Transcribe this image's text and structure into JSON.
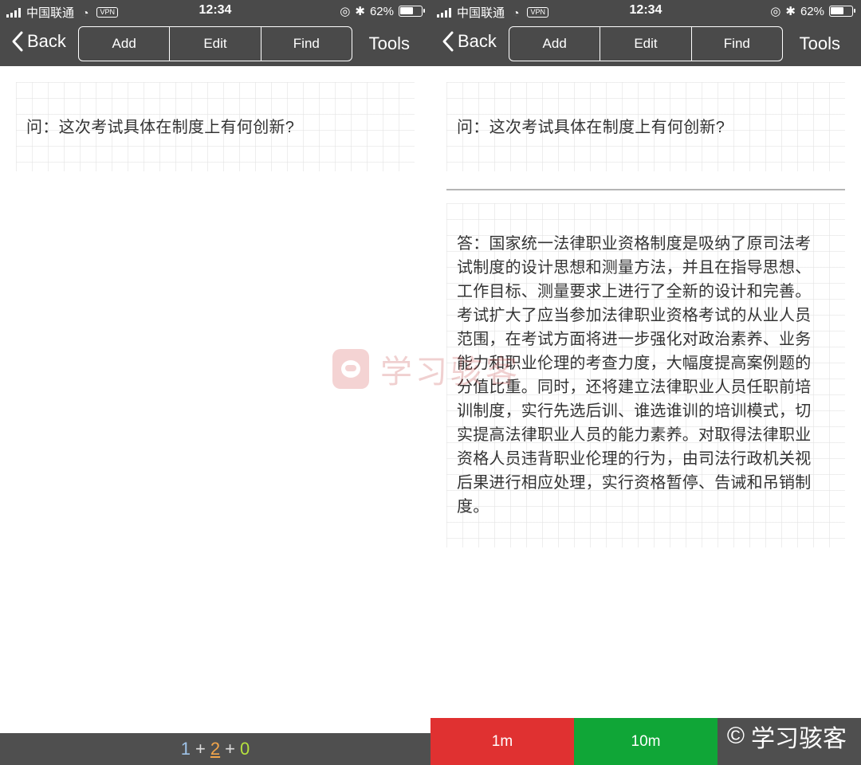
{
  "status": {
    "carrier": "中国联通",
    "vpn": "VPN",
    "time": "12:34",
    "battery": "62%",
    "battery_level": 0.62
  },
  "nav": {
    "back": "Back",
    "segments": [
      "Add",
      "Edit",
      "Find"
    ],
    "tools": "Tools"
  },
  "card": {
    "question": "问：这次考试具体在制度上有何创新?",
    "answer_lines": [
      "答：国家统一法律职业资格制度是吸纳了原司法考",
      "试制度的设计思想和测量方法，并且在指导思想、",
      "工作目标、测量要求上进行了全新的设计和完善。",
      "考试扩大了应当参加法律职业资格考试的从业人员",
      "范围，在考试方面将进一步强化对政治素养、业务",
      "能力和职业伦理的考查力度，大幅度提高案例题的",
      "分值比重。同时，还将建立法律职业人员任职前培",
      "训制度，实行先选后训、谁选谁训的培训模式，切",
      "实提高法律职业人员的能力素养。对取得法律职业",
      "资格人员违背职业伦理的行为，由司法行政机关视",
      "后果进行相应处理，实行资格暂停、告诫和吊销制",
      "度。"
    ]
  },
  "counts": {
    "new": "1",
    "learning": "2",
    "review": "0",
    "plus": "+"
  },
  "answer_buttons": {
    "again": "1m",
    "good": "10m"
  },
  "watermark": {
    "text": "学习骇客",
    "copyright": "©"
  },
  "colors": {
    "bar": "#4a4a4a",
    "again": "#e03131",
    "good": "#10a637",
    "count_new": "#9fc3e8",
    "count_learning": "#f2a54a",
    "count_review": "#b6e23e"
  }
}
